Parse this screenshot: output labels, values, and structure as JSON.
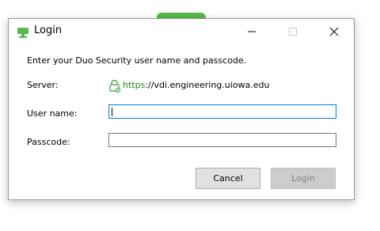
{
  "window": {
    "title": "Login"
  },
  "instructions": "Enter your Duo Security user name and passcode.",
  "server": {
    "label": "Server:",
    "url_scheme": "https",
    "url_rest": "://vdi.engineering.uiowa.edu"
  },
  "username": {
    "label": "User name:",
    "value": ""
  },
  "passcode": {
    "label": "Passcode:",
    "value": ""
  },
  "buttons": {
    "cancel": "Cancel",
    "login": "Login"
  },
  "colors": {
    "brand_green": "#58b94b",
    "https_green": "#1e8a1e",
    "focus_blue": "#0078d7"
  }
}
